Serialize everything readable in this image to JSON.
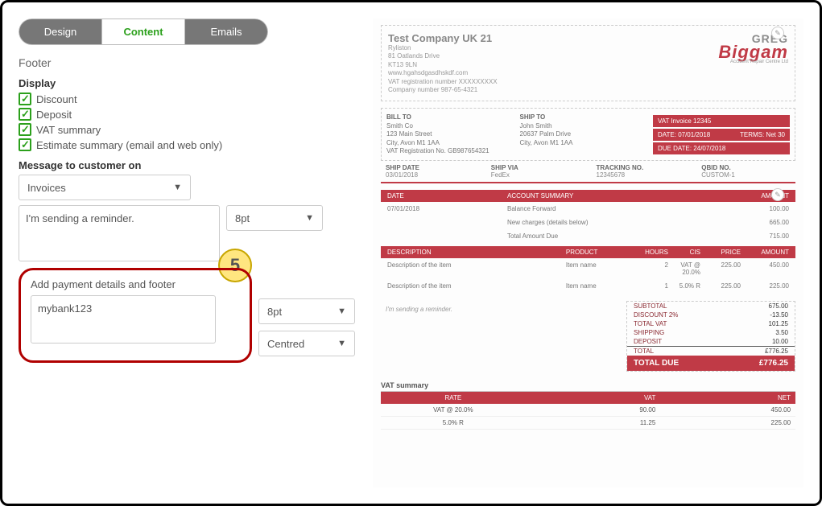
{
  "tabs": {
    "design": "Design",
    "content": "Content",
    "emails": "Emails"
  },
  "footer_label": "Footer",
  "display": {
    "heading": "Display",
    "discount": "Discount",
    "deposit": "Deposit",
    "vat_summary": "VAT summary",
    "estimate_summary": "Estimate summary (email and web only)"
  },
  "message": {
    "label": "Message to customer on",
    "target": "Invoices",
    "body": "I'm sending a reminder.",
    "size": "8pt"
  },
  "payment": {
    "label": "Add payment details and footer",
    "body": "mybank123",
    "size": "8pt",
    "align": "Centred"
  },
  "callout_number": "5",
  "preview": {
    "company": "Test Company UK 21",
    "addr": [
      "Ryliston",
      "81 Oatlands Drive",
      "KT13 9LN",
      "www.hgahsdgasdhskdf.com",
      "VAT registration number XXXXXXXXX",
      "Company number 987-65-4321"
    ],
    "logo": {
      "line1": "GREG",
      "line2": "Biggam",
      "sub": "Accident Repair Centre Ltd"
    },
    "billto_h": "BILL TO",
    "billto": [
      "Smith Co",
      "123 Main Street",
      "City, Avon M1 1AA",
      "VAT Registration No. GB987654321"
    ],
    "shipto_h": "SHIP TO",
    "shipto": [
      "John Smith",
      "20637 Palm Drive",
      "City, Avon M1 1AA"
    ],
    "invoice_label": "VAT Invoice  12345",
    "date_label": "DATE:  07/01/2018",
    "terms_label": "TERMS: Net 30",
    "due_label": "DUE DATE: 24/07/2018",
    "ship_date_h": "SHIP DATE",
    "ship_date": "03/01/2018",
    "ship_via_h": "SHIP VIA",
    "ship_via": "FedEx",
    "tracking_h": "TRACKING NO.",
    "tracking": "12345678",
    "qbid_h": "QBID NO.",
    "qbid": "CUSTOM-1",
    "as_head": {
      "date": "DATE",
      "acct": "ACCOUNT SUMMARY",
      "amt": "AMOUNT"
    },
    "as_rows": [
      {
        "date": "07/01/2018",
        "label": "Balance Forward",
        "amt": "100.00"
      },
      {
        "date": "",
        "label": "New charges (details below)",
        "amt": "665.00"
      },
      {
        "date": "",
        "label": "Total Amount Due",
        "amt": "715.00"
      }
    ],
    "line_head": {
      "desc": "DESCRIPTION",
      "prod": "PRODUCT",
      "hours": "HOURS",
      "cis": "CIS",
      "price": "PRICE",
      "amt": "AMOUNT"
    },
    "lines": [
      {
        "desc": "Description of the item",
        "prod": "Item name",
        "hours": "2",
        "cis": "VAT @ 20.0%",
        "price": "225.00",
        "amt": "450.00"
      },
      {
        "desc": "Description of the item",
        "prod": "Item name",
        "hours": "1",
        "cis": "5.0% R",
        "price": "225.00",
        "amt": "225.00"
      }
    ],
    "note": "I'm sending a reminder.",
    "totals": [
      {
        "label": "SUBTOTAL",
        "val": "675.00"
      },
      {
        "label": "DISCOUNT 2%",
        "val": "-13.50"
      },
      {
        "label": "TOTAL VAT",
        "val": "101.25"
      },
      {
        "label": "SHIPPING",
        "val": "3.50"
      },
      {
        "label": "DEPOSIT",
        "val": "10.00"
      },
      {
        "label": "TOTAL",
        "val": "£776.25"
      }
    ],
    "total_due": {
      "label": "TOTAL DUE",
      "val": "£776.25"
    },
    "vat_title": "VAT summary",
    "vat_head": {
      "rate": "RATE",
      "vat": "VAT",
      "net": "NET"
    },
    "vat_rows": [
      {
        "rate": "VAT @ 20.0%",
        "vat": "90.00",
        "net": "450.00"
      },
      {
        "rate": "5.0% R",
        "vat": "11.25",
        "net": "225.00"
      }
    ]
  }
}
